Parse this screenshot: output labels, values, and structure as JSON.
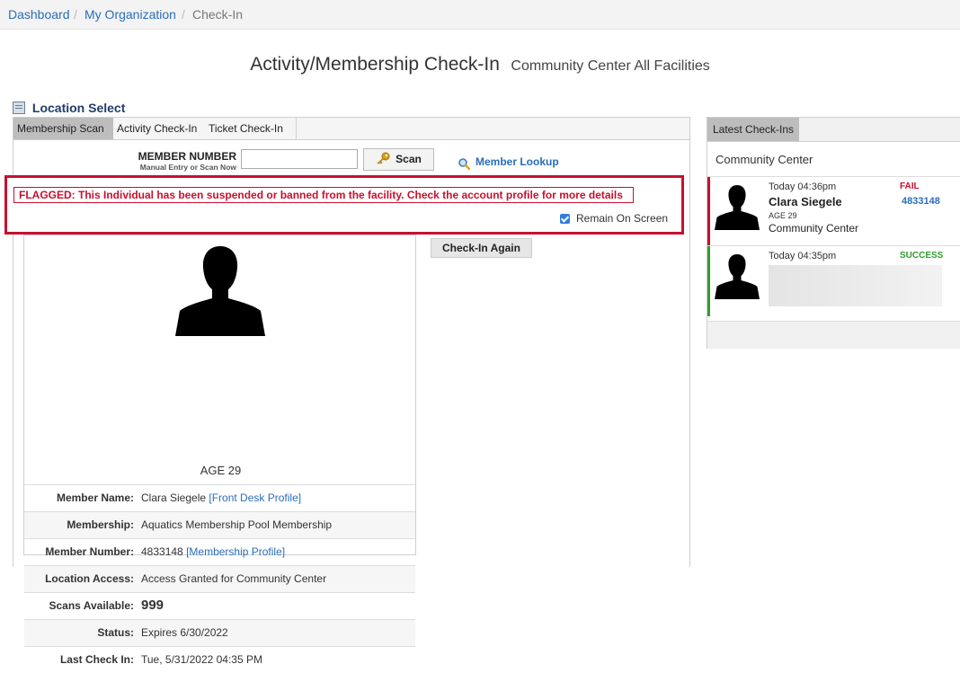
{
  "breadcrumb": {
    "dashboard": "Dashboard",
    "sep": "/",
    "org": "My Organization",
    "current": "Check-In"
  },
  "header": {
    "title": "Activity/Membership Check-In",
    "subtitle": "Community Center All Facilities"
  },
  "location_select": {
    "label": "Location Select",
    "icon": "list-icon"
  },
  "tabs": [
    "Membership Scan",
    "Activity Check-In",
    "Ticket Check-In"
  ],
  "active_tab": "Membership Scan",
  "scan_form": {
    "label": "MEMBER NUMBER",
    "hint": "Manual Entry or Scan Now",
    "input_value": "",
    "scan_button": "Scan",
    "scan_icon": "key-icon",
    "lookup_link": "Member Lookup",
    "lookup_icon": "magnifier-icon"
  },
  "flag": {
    "message": "FLAGGED: This Individual has been suspended or banned from the facility. Check the account profile for more details",
    "remain_label": "Remain On Screen",
    "remain_checked": true
  },
  "checkin_again": "Check-In Again",
  "member": {
    "age": "AGE 29",
    "rows": {
      "name": {
        "label": "Member Name:",
        "value": "Clara Siegele ",
        "link": "[Front Desk Profile]"
      },
      "membership": {
        "label": "Membership:",
        "value": "Aquatics Membership Pool Membership"
      },
      "number": {
        "label": "Member Number:",
        "value": "4833148 ",
        "link": "[Membership Profile]"
      },
      "access": {
        "label": "Location Access:",
        "value": "Access Granted for Community Center"
      },
      "scans": {
        "label": "Scans Available:",
        "value": "999"
      },
      "status": {
        "label": "Status:",
        "value": "Expires 6/30/2022"
      },
      "last": {
        "label": "Last Check In:",
        "value": "Tue, 5/31/2022 04:35 PM"
      }
    }
  },
  "latest": {
    "tab": "Latest Check-Ins",
    "location": "Community Center",
    "items": [
      {
        "time": "Today 04:36pm",
        "result": "FAIL",
        "name": "Clara Siegele",
        "number": "4833148",
        "age": "AGE 29",
        "location": "Community Center"
      },
      {
        "time": "Today 04:35pm",
        "result": "SUCCESS"
      }
    ]
  },
  "colors": {
    "fail": "#c8102e",
    "success": "#2e9e2e",
    "link": "#2a6ebb",
    "flag_border": "#c8102e"
  }
}
